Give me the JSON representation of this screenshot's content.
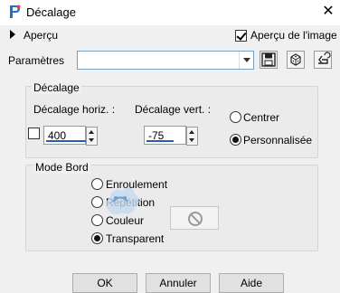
{
  "window": {
    "title": "Décalage",
    "close_glyph": "✕",
    "app_icon": "psp-brush-icon"
  },
  "preview": {
    "toggle_label": "Aperçu",
    "image_preview_label": "Aperçu de l'image",
    "image_preview_checked": true
  },
  "parameters": {
    "label": "Paramètres",
    "preset_value": "",
    "icons": [
      "save-preset-icon",
      "random-dice-icon",
      "reset-icon"
    ]
  },
  "offset_group": {
    "title": "Décalage",
    "horiz_label": "Décalage horiz. :",
    "horiz_value": "400",
    "vert_label": "Décalage vert. :",
    "vert_value": "-75",
    "link_checked": false,
    "options": [
      {
        "label": "Centrer",
        "selected": false
      },
      {
        "label": "Personnalisée",
        "selected": true
      }
    ]
  },
  "edge_mode_group": {
    "title": "Mode Bord",
    "options": [
      {
        "label": "Enroulement",
        "selected": false
      },
      {
        "label": "Répétition",
        "selected": false
      },
      {
        "label": "Couleur",
        "selected": false
      },
      {
        "label": "Transparent",
        "selected": true
      }
    ],
    "color_swatch_icon": "no-color-icon"
  },
  "buttons": {
    "ok": "OK",
    "cancel": "Annuler",
    "help": "Aide"
  }
}
